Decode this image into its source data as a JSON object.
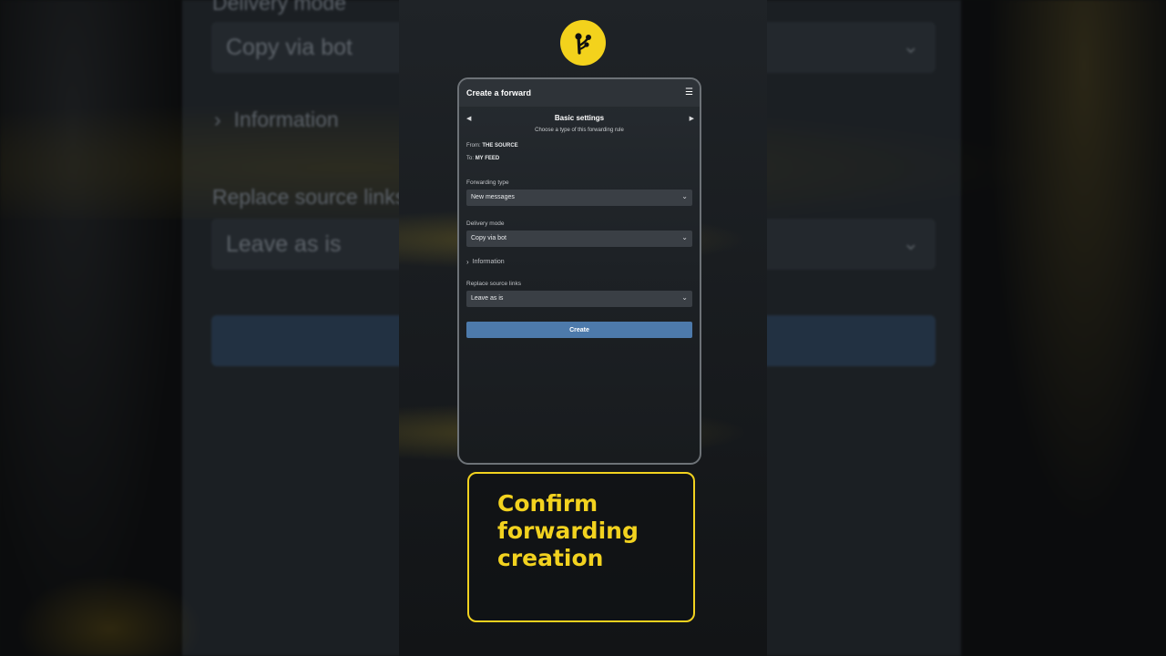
{
  "background": {
    "delivery_mode_label": "Delivery mode",
    "delivery_mode_value": "Copy via bot",
    "information_label": "Information",
    "replace_links_label": "Replace source links",
    "replace_links_value": "Leave as is"
  },
  "app": {
    "title": "Create a forward",
    "menu_icon": "hamburger-menu-icon"
  },
  "step": {
    "title": "Basic settings",
    "subtitle": "Choose a type of this forwarding rule",
    "prev_icon": "chevron-left-icon",
    "next_icon": "chevron-right-icon"
  },
  "route": {
    "from_label": "From:",
    "from_value": "THE SOURCE",
    "to_label": "To:",
    "to_value": "MY FEED"
  },
  "form": {
    "forwarding_type_label": "Forwarding type",
    "forwarding_type_value": "New messages",
    "delivery_mode_label": "Delivery mode",
    "delivery_mode_value": "Copy via bot",
    "information_label": "Information",
    "replace_links_label": "Replace source links",
    "replace_links_value": "Leave as is",
    "create_label": "Create"
  },
  "caption": {
    "text": "Confirm forwarding creation"
  },
  "colors": {
    "accent_yellow": "#f2d21f",
    "button_blue": "#4d7aab"
  }
}
